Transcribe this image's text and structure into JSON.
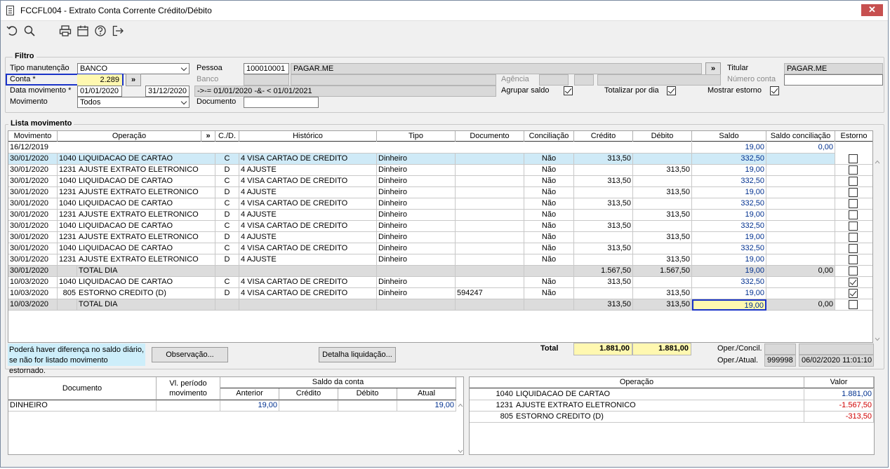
{
  "window": {
    "title": "FCCFL004 - Extrato Conta Corrente Crédito/Débito",
    "close": "✕"
  },
  "filtro": {
    "title": "Filtro",
    "tipo_manutencao_label": "Tipo manutenção",
    "tipo_manutencao_value": "BANCO",
    "conta_label": "Conta *",
    "conta_value": "2.289",
    "more": "»",
    "data_movimento_label": "Data movimento *",
    "data_inicio": "01/01/2020",
    "data_fim": "31/12/2020",
    "movimento_label": "Movimento",
    "movimento_value": "Todos",
    "pessoa_label": "Pessoa",
    "pessoa_code": "100010001",
    "pessoa_name": "PAGAR.ME",
    "banco_label": "Banco",
    "expressao": "->-= 01/01/2020 -&- < 01/01/2021",
    "documento_label": "Documento",
    "agencia_label": "Agência",
    "agrupar_saldo_label": "Agrupar saldo",
    "totalizar_por_dia_label": "Totalizar por dia",
    "mostrar_estorno_label": "Mostrar estorno",
    "titular_label": "Titular",
    "titular_value": "PAGAR.ME",
    "numero_conta_label": "Número conta"
  },
  "lista": {
    "title": "Lista movimento",
    "headers": {
      "movimento": "Movimento",
      "operacao": "Operação",
      "more": "»",
      "cd": "C./D.",
      "historico": "Histórico",
      "tipo": "Tipo",
      "documento": "Documento",
      "conciliacao": "Conciliação",
      "credito": "Crédito",
      "debito": "Débito",
      "saldo": "Saldo",
      "saldo_conciliacao": "Saldo conciliação",
      "estorno": "Estorno"
    },
    "first_row": {
      "date": "16/12/2019",
      "saldo": "19,00",
      "saldo_conc": "0,00"
    },
    "rows": [
      {
        "date": "30/01/2020",
        "code": "1040",
        "op": "LIQUIDACAO DE CARTAO",
        "cd": "C",
        "hist": "4 VISA CARTAO DE CREDITO",
        "tipo": "Dinheiro",
        "doc": "",
        "conc": "Não",
        "cred": "313,50",
        "deb": "",
        "saldo": "332,50",
        "sconc": "",
        "estorno": false,
        "sel": true,
        "tot": false
      },
      {
        "date": "30/01/2020",
        "code": "1231",
        "op": "AJUSTE EXTRATO ELETRONICO",
        "cd": "D",
        "hist": "4 AJUSTE",
        "tipo": "Dinheiro",
        "doc": "",
        "conc": "Não",
        "cred": "",
        "deb": "313,50",
        "saldo": "19,00",
        "sconc": "",
        "estorno": false,
        "sel": false,
        "tot": false
      },
      {
        "date": "30/01/2020",
        "code": "1040",
        "op": "LIQUIDACAO DE CARTAO",
        "cd": "C",
        "hist": "4 VISA CARTAO DE CREDITO",
        "tipo": "Dinheiro",
        "doc": "",
        "conc": "Não",
        "cred": "313,50",
        "deb": "",
        "saldo": "332,50",
        "sconc": "",
        "estorno": false,
        "sel": false,
        "tot": false
      },
      {
        "date": "30/01/2020",
        "code": "1231",
        "op": "AJUSTE EXTRATO ELETRONICO",
        "cd": "D",
        "hist": "4 AJUSTE",
        "tipo": "Dinheiro",
        "doc": "",
        "conc": "Não",
        "cred": "",
        "deb": "313,50",
        "saldo": "19,00",
        "sconc": "",
        "estorno": false,
        "sel": false,
        "tot": false
      },
      {
        "date": "30/01/2020",
        "code": "1040",
        "op": "LIQUIDACAO DE CARTAO",
        "cd": "C",
        "hist": "4 VISA CARTAO DE CREDITO",
        "tipo": "Dinheiro",
        "doc": "",
        "conc": "Não",
        "cred": "313,50",
        "deb": "",
        "saldo": "332,50",
        "sconc": "",
        "estorno": false,
        "sel": false,
        "tot": false
      },
      {
        "date": "30/01/2020",
        "code": "1231",
        "op": "AJUSTE EXTRATO ELETRONICO",
        "cd": "D",
        "hist": "4 AJUSTE",
        "tipo": "Dinheiro",
        "doc": "",
        "conc": "Não",
        "cred": "",
        "deb": "313,50",
        "saldo": "19,00",
        "sconc": "",
        "estorno": false,
        "sel": false,
        "tot": false
      },
      {
        "date": "30/01/2020",
        "code": "1040",
        "op": "LIQUIDACAO DE CARTAO",
        "cd": "C",
        "hist": "4 VISA CARTAO DE CREDITO",
        "tipo": "Dinheiro",
        "doc": "",
        "conc": "Não",
        "cred": "313,50",
        "deb": "",
        "saldo": "332,50",
        "sconc": "",
        "estorno": false,
        "sel": false,
        "tot": false
      },
      {
        "date": "30/01/2020",
        "code": "1231",
        "op": "AJUSTE EXTRATO ELETRONICO",
        "cd": "D",
        "hist": "4 AJUSTE",
        "tipo": "Dinheiro",
        "doc": "",
        "conc": "Não",
        "cred": "",
        "deb": "313,50",
        "saldo": "19,00",
        "sconc": "",
        "estorno": false,
        "sel": false,
        "tot": false
      },
      {
        "date": "30/01/2020",
        "code": "1040",
        "op": "LIQUIDACAO DE CARTAO",
        "cd": "C",
        "hist": "4 VISA CARTAO DE CREDITO",
        "tipo": "Dinheiro",
        "doc": "",
        "conc": "Não",
        "cred": "313,50",
        "deb": "",
        "saldo": "332,50",
        "sconc": "",
        "estorno": false,
        "sel": false,
        "tot": false
      },
      {
        "date": "30/01/2020",
        "code": "1231",
        "op": "AJUSTE EXTRATO ELETRONICO",
        "cd": "D",
        "hist": "4 AJUSTE",
        "tipo": "Dinheiro",
        "doc": "",
        "conc": "Não",
        "cred": "",
        "deb": "313,50",
        "saldo": "19,00",
        "sconc": "",
        "estorno": false,
        "sel": false,
        "tot": false
      },
      {
        "date": "30/01/2020",
        "code": "",
        "op": "TOTAL DIA",
        "cd": "",
        "hist": "",
        "tipo": "",
        "doc": "",
        "conc": "",
        "cred": "1.567,50",
        "deb": "1.567,50",
        "saldo": "19,00",
        "sconc": "0,00",
        "estorno": false,
        "sel": false,
        "tot": true
      },
      {
        "date": "10/03/2020",
        "code": "1040",
        "op": "LIQUIDACAO DE CARTAO",
        "cd": "C",
        "hist": "4 VISA CARTAO DE CREDITO",
        "tipo": "Dinheiro",
        "doc": "",
        "conc": "Não",
        "cred": "313,50",
        "deb": "",
        "saldo": "332,50",
        "sconc": "",
        "estorno": true,
        "sel": false,
        "tot": false
      },
      {
        "date": "10/03/2020",
        "code": "805",
        "op": "ESTORNO CREDITO (D)",
        "cd": "D",
        "hist": "4 VISA CARTAO DE CREDITO",
        "tipo": "Dinheiro",
        "doc": "594247",
        "conc": "Não",
        "cred": "",
        "deb": "313,50",
        "saldo": "19,00",
        "sconc": "",
        "estorno": true,
        "sel": false,
        "tot": false
      },
      {
        "date": "10/03/2020",
        "code": "",
        "op": "TOTAL DIA",
        "cd": "",
        "hist": "",
        "tipo": "",
        "doc": "",
        "conc": "",
        "cred": "313,50",
        "deb": "313,50",
        "saldo": "19,00",
        "sconc": "0,00",
        "estorno": false,
        "sel": false,
        "tot": true
      }
    ]
  },
  "footer": {
    "note_line1": "Poderá haver diferença no saldo diário,",
    "note_line2": "se não for listado movimento estornado.",
    "observacao_button": "Observação...",
    "detalha_button": "Detalha liquidação...",
    "total_label": "Total",
    "total_credito": "1.881,00",
    "total_debito": "1.881,00",
    "oper_concil_label": "Oper./Concil.",
    "oper_atual_label": "Oper./Atual.",
    "oper_atual_code": "999998",
    "oper_atual_date": "06/02/2020 11:01:10"
  },
  "documento_grid": {
    "headers": {
      "documento": "Documento",
      "vl_periodo_1": "Vl. período",
      "vl_periodo_2": "movimento",
      "saldo_conta": "Saldo da conta",
      "anterior": "Anterior",
      "credito": "Crédito",
      "debito": "Débito",
      "atual": "Atual"
    },
    "rows": [
      {
        "doc": "DINHEIRO",
        "vl": "",
        "anterior": "19,00",
        "credito": "",
        "debito": "",
        "atual": "19,00"
      }
    ]
  },
  "operacao_grid": {
    "headers": {
      "operacao": "Operação",
      "valor": "Valor"
    },
    "rows": [
      {
        "code": "1040",
        "op": "LIQUIDACAO DE CARTAO",
        "valor": "1.881,00",
        "neg": false
      },
      {
        "code": "1231",
        "op": "AJUSTE EXTRATO ELETRONICO",
        "valor": "-1.567,50",
        "neg": true
      },
      {
        "code": "805",
        "op": "ESTORNO CREDITO (D)",
        "valor": "-313,50",
        "neg": true
      }
    ]
  },
  "colors": {
    "selected_row": "#cfeaf7",
    "total_row": "#dcdcdc",
    "highlight": "#fff8b0",
    "focus_border": "#1a33c8",
    "positive": "#00308f",
    "negative": "#d00000"
  }
}
